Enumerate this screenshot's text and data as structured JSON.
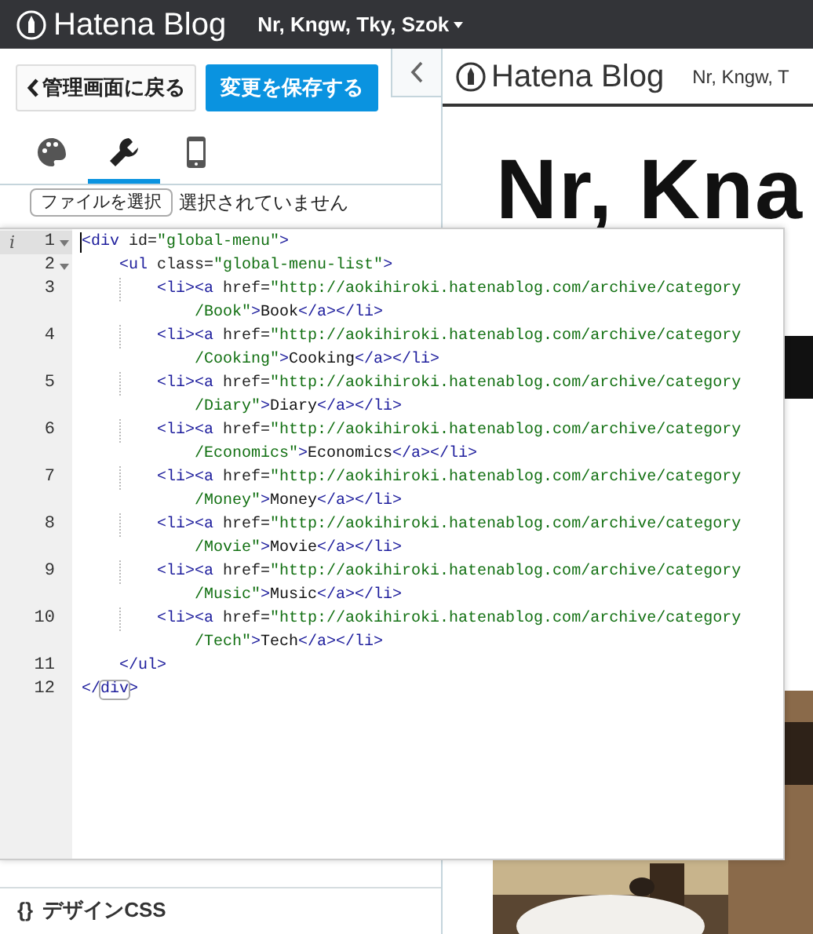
{
  "top_bar": {
    "brand": "Hatena Blog",
    "blog_menu": "Nr, Kngw, Tky, Szok"
  },
  "editor_panel": {
    "back_button": "管理画面に戻る",
    "save_button": "変更を保存する",
    "tabs": [
      {
        "kind": "palette",
        "selected": false
      },
      {
        "kind": "wrench",
        "selected": true
      },
      {
        "kind": "phone",
        "selected": false
      }
    ],
    "file_button": "ファイルを選択",
    "file_status": "選択されていません",
    "section_title": "デザインCSS",
    "section_icon": "{}"
  },
  "code_editor": {
    "lines": [
      {
        "number": "1",
        "active": true,
        "marker": "i",
        "expanded": true,
        "tokens": [
          {
            "kind": "tag",
            "text": "<div"
          },
          {
            "kind": "attr",
            "text": " id="
          },
          {
            "kind": "string",
            "text": "\"global-menu\""
          },
          {
            "kind": "tag",
            "text": ">"
          }
        ],
        "children": [
          {
            "number": "2",
            "active": false,
            "expanded": true,
            "tokens": [
              {
                "kind": "tag",
                "text": "<ul"
              },
              {
                "kind": "attr",
                "text": " class="
              },
              {
                "kind": "string",
                "text": "\"global-menu-list\""
              },
              {
                "kind": "tag",
                "text": ">"
              }
            ],
            "children": [
              {
                "number": "3",
                "active": false,
                "tokens": [
                  {
                    "kind": "tag",
                    "text": "<li><a"
                  },
                  {
                    "kind": "attr",
                    "text": " href="
                  },
                  {
                    "kind": "string",
                    "text": "\"http://aokihiroki.hatenablog.com/archive/category"
                  }
                ],
                "wrap": [
                  {
                    "kind": "string",
                    "text": "/Book\""
                  },
                  {
                    "kind": "tag",
                    "text": ">"
                  },
                  {
                    "kind": "text",
                    "text": "Book"
                  },
                  {
                    "kind": "tag",
                    "text": "</a></li>"
                  }
                ]
              },
              {
                "number": "4",
                "active": false,
                "tokens": [
                  {
                    "kind": "tag",
                    "text": "<li><a"
                  },
                  {
                    "kind": "attr",
                    "text": " href="
                  },
                  {
                    "kind": "string",
                    "text": "\"http://aokihiroki.hatenablog.com/archive/category"
                  }
                ],
                "wrap": [
                  {
                    "kind": "string",
                    "text": "/Cooking\""
                  },
                  {
                    "kind": "tag",
                    "text": ">"
                  },
                  {
                    "kind": "text",
                    "text": "Cooking"
                  },
                  {
                    "kind": "tag",
                    "text": "</a></li>"
                  }
                ]
              },
              {
                "number": "5",
                "active": false,
                "tokens": [
                  {
                    "kind": "tag",
                    "text": "<li><a"
                  },
                  {
                    "kind": "attr",
                    "text": " href="
                  },
                  {
                    "kind": "string",
                    "text": "\"http://aokihiroki.hatenablog.com/archive/category"
                  }
                ],
                "wrap": [
                  {
                    "kind": "string",
                    "text": "/Diary\""
                  },
                  {
                    "kind": "tag",
                    "text": ">"
                  },
                  {
                    "kind": "text",
                    "text": "Diary"
                  },
                  {
                    "kind": "tag",
                    "text": "</a></li>"
                  }
                ]
              },
              {
                "number": "6",
                "active": false,
                "tokens": [
                  {
                    "kind": "tag",
                    "text": "<li><a"
                  },
                  {
                    "kind": "attr",
                    "text": " href="
                  },
                  {
                    "kind": "string",
                    "text": "\"http://aokihiroki.hatenablog.com/archive/category"
                  }
                ],
                "wrap": [
                  {
                    "kind": "string",
                    "text": "/Economics\""
                  },
                  {
                    "kind": "tag",
                    "text": ">"
                  },
                  {
                    "kind": "text",
                    "text": "Economics"
                  },
                  {
                    "kind": "tag",
                    "text": "</a></li>"
                  }
                ]
              },
              {
                "number": "7",
                "active": false,
                "tokens": [
                  {
                    "kind": "tag",
                    "text": "<li><a"
                  },
                  {
                    "kind": "attr",
                    "text": " href="
                  },
                  {
                    "kind": "string",
                    "text": "\"http://aokihiroki.hatenablog.com/archive/category"
                  }
                ],
                "wrap": [
                  {
                    "kind": "string",
                    "text": "/Money\""
                  },
                  {
                    "kind": "tag",
                    "text": ">"
                  },
                  {
                    "kind": "text",
                    "text": "Money"
                  },
                  {
                    "kind": "tag",
                    "text": "</a></li>"
                  }
                ]
              },
              {
                "number": "8",
                "active": false,
                "tokens": [
                  {
                    "kind": "tag",
                    "text": "<li><a"
                  },
                  {
                    "kind": "attr",
                    "text": " href="
                  },
                  {
                    "kind": "string",
                    "text": "\"http://aokihiroki.hatenablog.com/archive/category"
                  }
                ],
                "wrap": [
                  {
                    "kind": "string",
                    "text": "/Movie\""
                  },
                  {
                    "kind": "tag",
                    "text": ">"
                  },
                  {
                    "kind": "text",
                    "text": "Movie"
                  },
                  {
                    "kind": "tag",
                    "text": "</a></li>"
                  }
                ]
              },
              {
                "number": "9",
                "active": false,
                "tokens": [
                  {
                    "kind": "tag",
                    "text": "<li><a"
                  },
                  {
                    "kind": "attr",
                    "text": " href="
                  },
                  {
                    "kind": "string",
                    "text": "\"http://aokihiroki.hatenablog.com/archive/category"
                  }
                ],
                "wrap": [
                  {
                    "kind": "string",
                    "text": "/Music\""
                  },
                  {
                    "kind": "tag",
                    "text": ">"
                  },
                  {
                    "kind": "text",
                    "text": "Music"
                  },
                  {
                    "kind": "tag",
                    "text": "</a></li>"
                  }
                ]
              },
              {
                "number": "10",
                "active": false,
                "tokens": [
                  {
                    "kind": "tag",
                    "text": "<li><a"
                  },
                  {
                    "kind": "attr",
                    "text": " href="
                  },
                  {
                    "kind": "string",
                    "text": "\"http://aokihiroki.hatenablog.com/archive/category"
                  }
                ],
                "wrap": [
                  {
                    "kind": "string",
                    "text": "/Tech\""
                  },
                  {
                    "kind": "tag",
                    "text": ">"
                  },
                  {
                    "kind": "text",
                    "text": "Tech"
                  },
                  {
                    "kind": "tag",
                    "text": "</a></li>"
                  }
                ]
              }
            ]
          },
          {
            "number": "11",
            "active": false,
            "tokens": [
              {
                "kind": "tag",
                "text": "</ul>"
              }
            ]
          }
        ]
      },
      {
        "number": "12",
        "active": false,
        "tokens": [
          {
            "kind": "tag",
            "text": "</"
          },
          {
            "kind": "match",
            "text": "div"
          },
          {
            "kind": "tag",
            "text": ">"
          }
        ]
      }
    ]
  },
  "preview": {
    "brand": "Hatena Blog",
    "blog_name": "Nr, Kngw, T",
    "title": "Nr, Kna"
  }
}
